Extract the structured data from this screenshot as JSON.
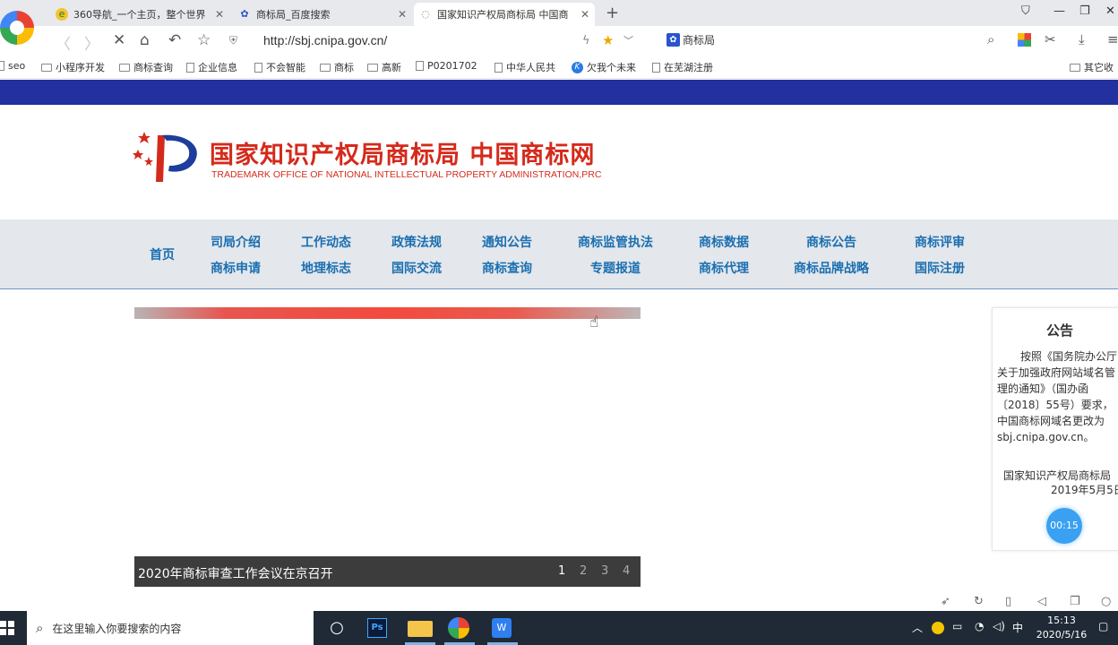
{
  "browser": {
    "tabs": [
      {
        "title": "360导航_一个主页，整个世界",
        "icon": "360-icon"
      },
      {
        "title": "商标局_百度搜索",
        "icon": "baidu-paw-icon"
      },
      {
        "title": "国家知识产权局商标局 中国商",
        "icon": "loading-icon"
      }
    ],
    "new_tab": "+",
    "url": "http://sbj.cnipa.gov.cn/",
    "search_engine_label": "商标局",
    "bookmarks": [
      "seo",
      "小程序开发",
      "商标查询",
      "企业信息",
      "不会智能",
      "商标",
      "高新",
      "P0201702",
      "中华人民共",
      "欠我个未来",
      "在芜湖注册"
    ],
    "other_bookmarks": "其它收"
  },
  "site": {
    "title_cn": "国家知识产权局商标局 中国商标网",
    "title_en": "TRADEMARK OFFICE OF NATIONAL INTELLECTUAL PROPERTY ADMINISTRATION,PRC",
    "nav": {
      "home": "首页",
      "row1": [
        "司局介绍",
        "工作动态",
        "政策法规",
        "通知公告",
        "商标监管执法",
        "商标数据",
        "商标公告",
        "商标评审"
      ],
      "row2": [
        "商标申请",
        "地理标志",
        "国际交流",
        "商标查询",
        "专题报道",
        "商标代理",
        "商标品牌战略",
        "国际注册"
      ]
    },
    "slider": {
      "caption": "2020年商标审查工作会议在京召开",
      "pages": [
        "1",
        "2",
        "3",
        "4"
      ],
      "active_page": "1"
    },
    "notice": {
      "title": "公告",
      "body": "按照《国务院办公厅关于加强政府网站域名管理的通知》（国办函〔2018〕55号）要求，中国商标网域名更改为sbj.cnipa.gov.cn。",
      "signature": "国家知识产权局商标局",
      "date": "2019年5月5日"
    },
    "timer": "00:15"
  },
  "taskbar": {
    "search_placeholder": "在这里输入你要搜索的内容",
    "ime": "中",
    "time": "15:13",
    "date": "2020/5/16"
  },
  "colors": {
    "brand_red": "#d42a1b",
    "nav_blue": "#1a6fb1",
    "top_band": "#2330a0"
  }
}
